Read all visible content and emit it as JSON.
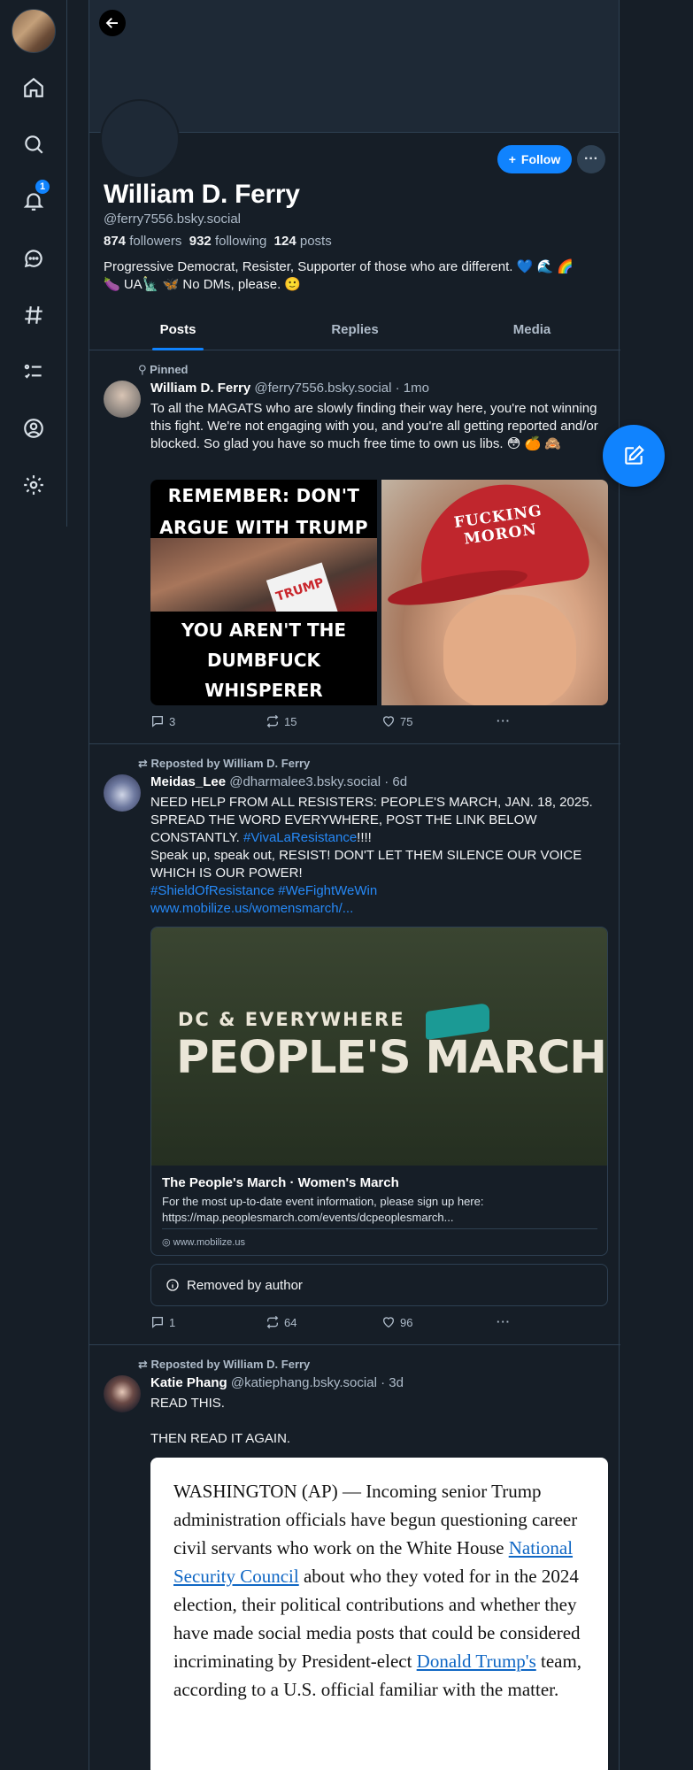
{
  "nav": {
    "notifications_badge": "1",
    "items": [
      "home-icon",
      "search-icon",
      "bell-icon",
      "chat-icon",
      "hashtag-icon",
      "list-icon",
      "profile-icon",
      "gear-icon"
    ]
  },
  "profile": {
    "name": "William D. Ferry",
    "handle": "@ferry7556.bsky.social",
    "followers_count": "874",
    "followers_label": "followers",
    "following_count": "932",
    "following_label": "following",
    "posts_count": "124",
    "posts_label": "posts",
    "bio_line1": "Progressive Democrat, Resister, Supporter of those who are different. 💙 🌊 🌈",
    "bio_line2": "🍆 UA🗽 🦋 No DMs, please. 🙂",
    "follow_label": "Follow",
    "more_label": "···"
  },
  "tabs": [
    "Posts",
    "Replies",
    "Media"
  ],
  "posts": [
    {
      "context": "Pinned",
      "author": "William D. Ferry",
      "handle": "@ferry7556.bsky.social · 1mo",
      "text": "To all the MAGATS who are slowly finding their way here, you're not winning this fight. We're not engaging with you, and you're all getting reported and/or blocked. So glad you have so much free time to own us libs. 😳 🍊 🙈",
      "image1_top": "REMEMBER: DON'T ARGUE WITH TRUMP TROLLS",
      "image1_bottom": "YOU AREN'T THE DUMBFUCK WHISPERER",
      "image1_sign": "TRUMP",
      "image2_hat": "FUCKING MORON",
      "replies": "3",
      "reposts": "15",
      "likes": "75"
    },
    {
      "context": "Reposted by William D. Ferry",
      "author": "Meidas_Lee",
      "handle": "@dharmalee3.bsky.social · 6d",
      "text_line1": "NEED HELP FROM ALL RESISTERS: PEOPLE'S MARCH, JAN. 18, 2025. SPREAD THE WORD EVERYWHERE, POST THE LINK BELOW CONSTANTLY. ",
      "hashtag1": "#VivaLaResistance",
      "text_excl": "!!!!",
      "text_line2": "Speak up, speak out, RESIST! DON'T LET THEM SILENCE OUR VOICE WHICH IS OUR POWER!",
      "hashtag2": "#ShieldOfResistance",
      "hashtag3": "#WeFightWeWin",
      "link": "www.mobilize.us/womensmarch/...",
      "card": {
        "image_sub": "DC & EVERYWHERE",
        "image_big": "PEOPLE'S MARCH",
        "title": "The People's March · Women's March",
        "description": "For the most up-to-date event information, please sign up here: https://map.peoplesmarch.com/events/dcpeoplesmarch...",
        "domain": "www.mobilize.us"
      },
      "removed_label": "Removed by author",
      "replies": "1",
      "reposts": "64",
      "likes": "96"
    },
    {
      "context": "Reposted by William D. Ferry",
      "author": "Katie Phang",
      "handle": "@katiephang.bsky.social · 3d",
      "text_line1": "READ THIS.",
      "text_line2": "THEN READ IT AGAIN.",
      "news_1": "WASHINGTON (AP) — Incoming senior Trump administration officials have begun questioning career civil servants who work on the White House ",
      "news_link1": "National Security Council",
      "news_2": " about who they voted for in the 2024 election, their political contributions and whether they have made social media posts that could be considered incriminating by President-elect ",
      "news_link2": "Donald Trump's",
      "news_3": " team, according to a U.S. official familiar with the matter."
    }
  ]
}
